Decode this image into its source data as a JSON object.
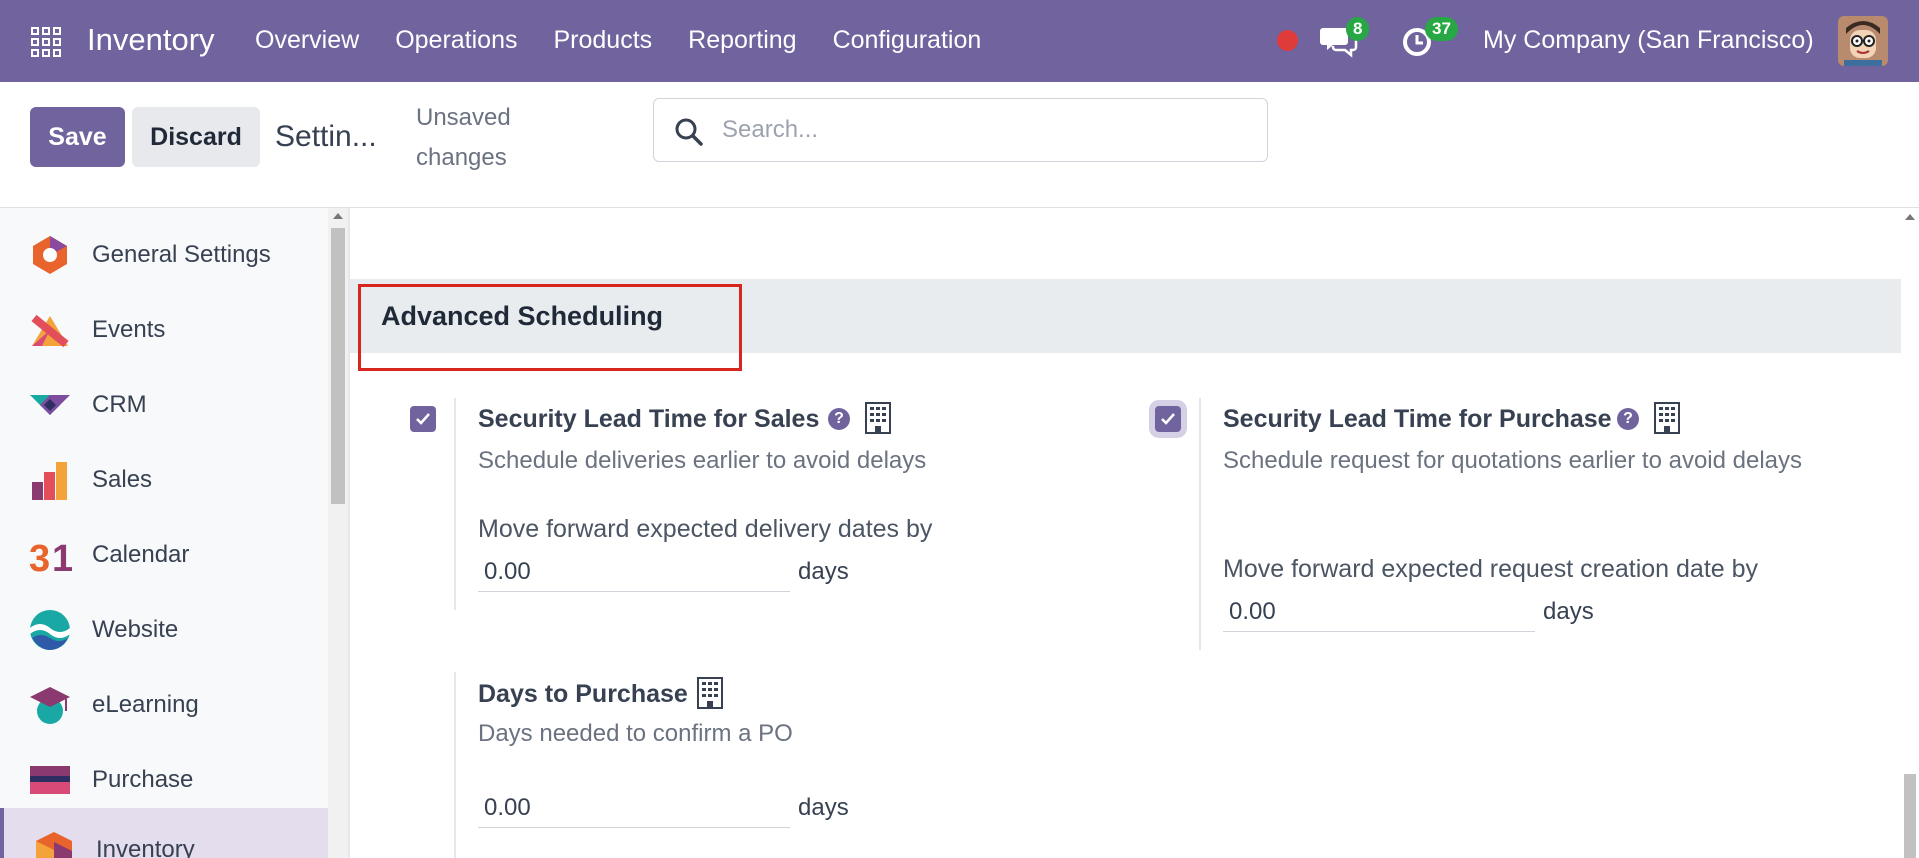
{
  "navbar": {
    "app_name": "Inventory",
    "menu": [
      "Overview",
      "Operations",
      "Products",
      "Reporting",
      "Configuration"
    ],
    "messages_count": "8",
    "activities_count": "37",
    "company": "My Company (San Francisco)"
  },
  "control_panel": {
    "save_label": "Save",
    "discard_label": "Discard",
    "title": "Settin...",
    "status": "Unsaved changes",
    "search_placeholder": "Search..."
  },
  "sidebar": {
    "items": [
      {
        "label": "General Settings",
        "icon": "general-settings-icon"
      },
      {
        "label": "Events",
        "icon": "events-icon"
      },
      {
        "label": "CRM",
        "icon": "crm-icon"
      },
      {
        "label": "Sales",
        "icon": "sales-icon"
      },
      {
        "label": "Calendar",
        "icon": "calendar-icon"
      },
      {
        "label": "Website",
        "icon": "website-icon"
      },
      {
        "label": "eLearning",
        "icon": "elearning-icon"
      },
      {
        "label": "Purchase",
        "icon": "purchase-icon"
      },
      {
        "label": "Inventory",
        "icon": "inventory-icon",
        "active": true
      }
    ]
  },
  "section": {
    "title": "Advanced Scheduling",
    "settings": {
      "sales": {
        "checked": true,
        "title": "Security Lead Time for Sales",
        "description": "Schedule deliveries earlier to avoid delays",
        "field_label": "Move forward expected delivery dates by",
        "value": "0.00",
        "unit": "days"
      },
      "purchase": {
        "checked": true,
        "title": "Security Lead Time for Purchase",
        "description": "Schedule request for quotations earlier to avoid delays",
        "field_label": "Move forward expected request creation date by",
        "value": "0.00",
        "unit": "days"
      },
      "days_to_purchase": {
        "title": "Days to Purchase",
        "description": "Days needed to confirm a PO",
        "value": "0.00",
        "unit": "days"
      }
    }
  },
  "colors": {
    "brand": "#71639e",
    "badge": "#28a745",
    "highlight": "#d7261e"
  }
}
